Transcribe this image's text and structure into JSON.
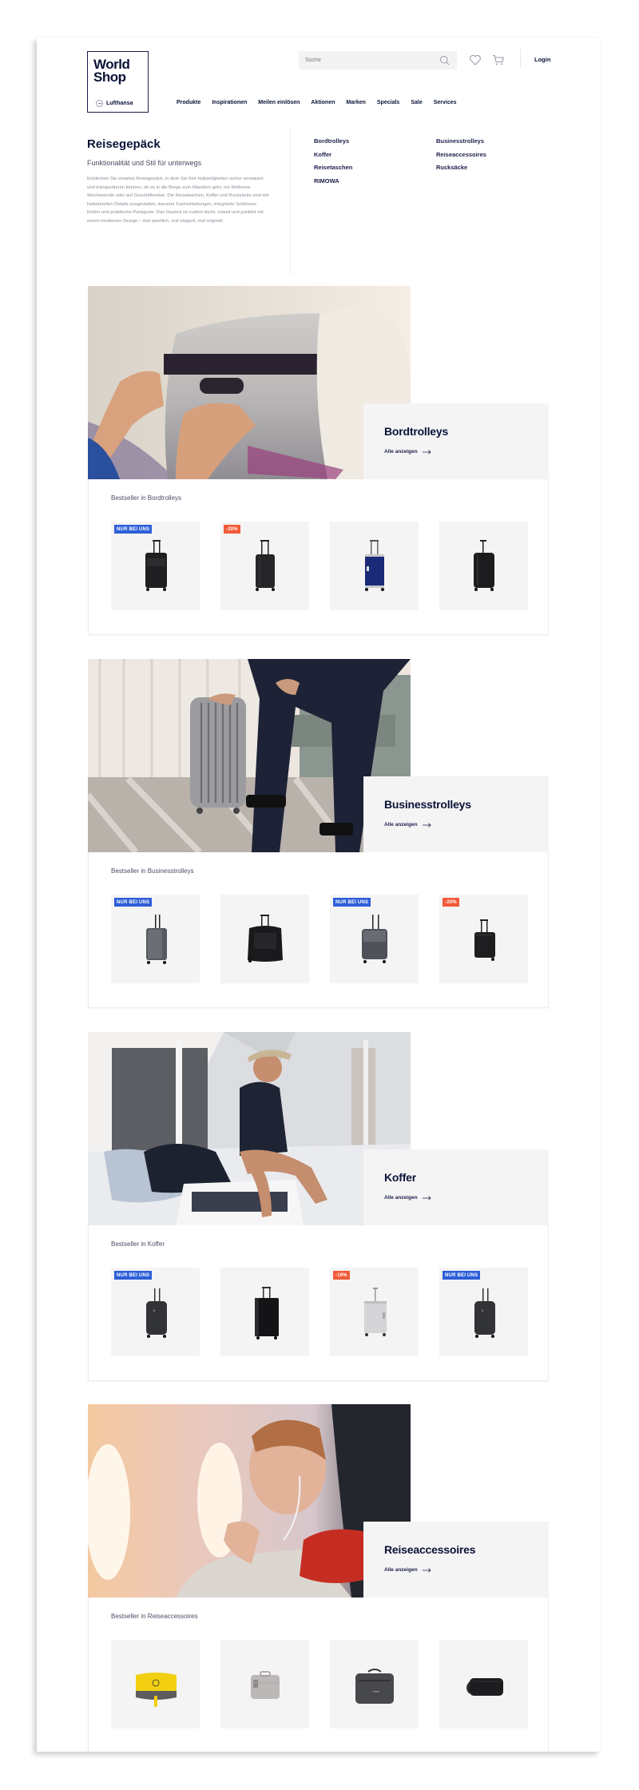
{
  "header": {
    "logo_title": "World Shop",
    "logo_sub": "Lufthansa",
    "search_placeholder": "Suche",
    "login_label": "Login",
    "nav": [
      "Produkte",
      "Inspirationen",
      "Meilen einlösen",
      "Aktionen",
      "Marken",
      "Specials",
      "Sale",
      "Services"
    ]
  },
  "intro": {
    "title": "Reisegepäck",
    "subtitle": "Funktionalität und Stil für unterwegs",
    "text": "Entdecken Sie smartes Reisegepäck, in dem Sie Ihre Habseligkeiten sicher verstauen und transportieren können, ob es in die Berge zum Wandern geht, ins Wellness-Wochenende oder auf Geschäftsreise. Die Reisetaschen, Koffer und Rucksäcke sind mit funktionellen Details ausgestattet, darunter Facheinteilungen, integrierte Schlösser, Rollen und praktische Packgurte. Das Gepäck ist zudem leicht, robust und punktet mit einem modernen Design – mal sportlich, mal elegant, mal originell.",
    "category_links": [
      "Bordtrolleys",
      "Businesstrolleys",
      "Koffer",
      "Reiseaccessoires",
      "Reisetaschen",
      "Rucksäcke",
      "RIMOWA"
    ]
  },
  "colors": {
    "brand_navy": "#0b1236",
    "badge_exclusive": "#2e5fd8",
    "badge_sale": "#f25a38",
    "panel_bg": "#f4f4f5",
    "tile_bg": "#f4f4f4"
  },
  "sections": [
    {
      "title": "Bordtrolleys",
      "link_label": "Alle anzeigen",
      "image": "hand-closing-suitcase-in-overhead-bin",
      "bestseller_label": "Bestseller in Bordtrolleys",
      "products": [
        {
          "badge": "NUR BEI UNS",
          "badge_type": "exclusive",
          "kind": "soft-trolley-black"
        },
        {
          "badge": "-20%",
          "badge_type": "sale",
          "kind": "hard-trolley-black"
        },
        {
          "badge": "",
          "badge_type": "",
          "kind": "hard-trolley-navy"
        },
        {
          "badge": "",
          "badge_type": "",
          "kind": "hard-trolley-black"
        }
      ]
    },
    {
      "title": "Businesstrolleys",
      "link_label": "Alle anzeigen",
      "image": "businessman-with-silver-suitcase",
      "bestseller_label": "Bestseller in Businesstrolleys",
      "products": [
        {
          "badge": "NUR BEI UNS",
          "badge_type": "exclusive",
          "kind": "business-trolley-grey"
        },
        {
          "badge": "",
          "badge_type": "",
          "kind": "business-bag-black"
        },
        {
          "badge": "NUR BEI UNS",
          "badge_type": "exclusive",
          "kind": "business-trolley-grey-wide"
        },
        {
          "badge": "-20%",
          "badge_type": "sale",
          "kind": "business-trolley-black"
        }
      ]
    },
    {
      "title": "Koffer",
      "link_label": "Alle anzeigen",
      "image": "woman-packing-suitcase-on-bed",
      "bestseller_label": "Bestseller in Koffer",
      "products": [
        {
          "badge": "NUR BEI UNS",
          "badge_type": "exclusive",
          "kind": "hard-case-dark"
        },
        {
          "badge": "",
          "badge_type": "",
          "kind": "hard-case-black-large"
        },
        {
          "badge": "-19%",
          "badge_type": "sale",
          "kind": "aluminium-case-silver"
        },
        {
          "badge": "NUR BEI UNS",
          "badge_type": "exclusive",
          "kind": "hard-case-dark"
        }
      ]
    },
    {
      "title": "Reiseaccessoires",
      "link_label": "Alle anzeigen",
      "image": "man-with-neck-pillow-in-plane",
      "bestseller_label": "Bestseller in Reiseaccessoires",
      "products": [
        {
          "badge": "",
          "badge_type": "",
          "kind": "yellow-amenity-kit"
        },
        {
          "badge": "",
          "badge_type": "",
          "kind": "silver-beauty-case"
        },
        {
          "badge": "",
          "badge_type": "",
          "kind": "grey-laptop-bag"
        },
        {
          "badge": "",
          "badge_type": "",
          "kind": "black-toiletry-bag"
        }
      ]
    }
  ]
}
